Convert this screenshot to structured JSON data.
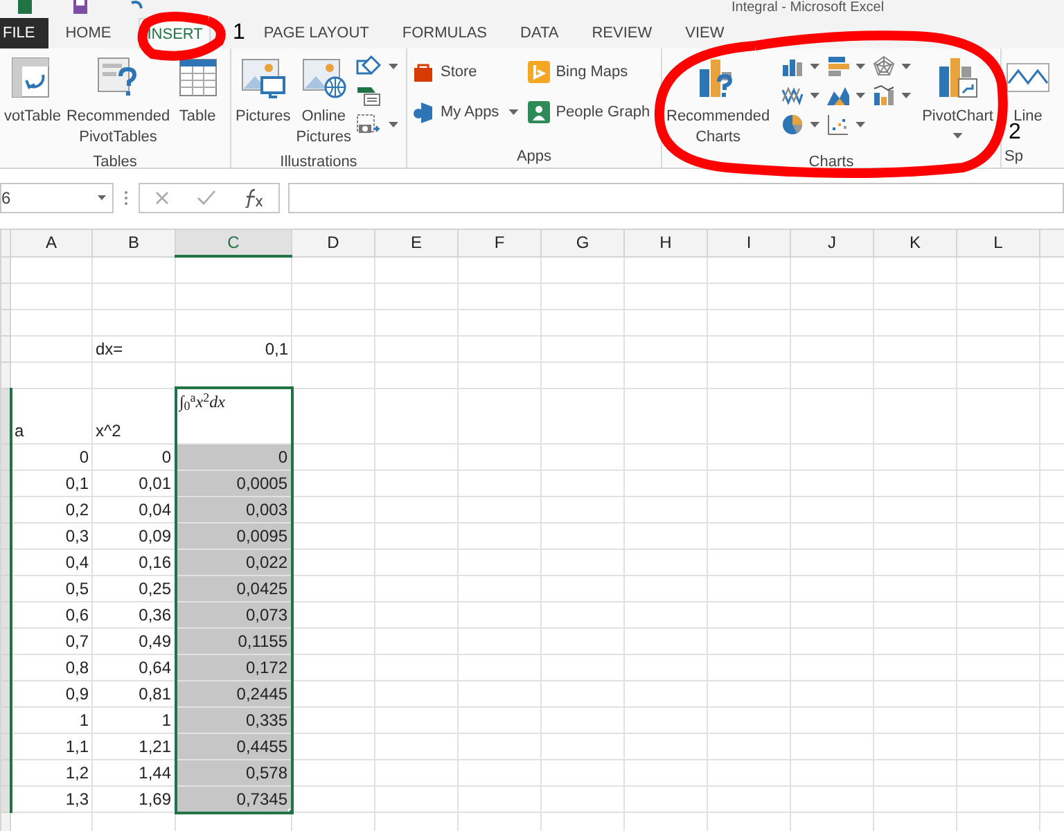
{
  "window": {
    "title": "Integral - Microsoft Excel"
  },
  "tabs": [
    {
      "label": "FILE",
      "kind": "file",
      "selected": false
    },
    {
      "label": "HOME",
      "kind": "tab",
      "selected": false
    },
    {
      "label": "INSERT",
      "kind": "tab",
      "selected": true
    },
    {
      "label": "PAGE LAYOUT",
      "kind": "tab",
      "selected": false
    },
    {
      "label": "FORMULAS",
      "kind": "tab",
      "selected": false
    },
    {
      "label": "DATA",
      "kind": "tab",
      "selected": false
    },
    {
      "label": "REVIEW",
      "kind": "tab",
      "selected": false
    },
    {
      "label": "VIEW",
      "kind": "tab",
      "selected": false
    }
  ],
  "annotations": [
    {
      "text": "1"
    },
    {
      "text": "2"
    }
  ],
  "ribbon": {
    "groups": [
      {
        "label": "Tables",
        "items": [
          {
            "kind": "large",
            "label": "votTable"
          },
          {
            "kind": "large",
            "label": "Recommended PivotTables"
          },
          {
            "kind": "large",
            "label": "Table"
          }
        ]
      },
      {
        "label": "Illustrations",
        "items": [
          {
            "kind": "large",
            "label": "Pictures"
          },
          {
            "kind": "large",
            "label": "Online Pictures"
          },
          {
            "kind": "icon",
            "dropdown": true
          },
          {
            "kind": "icon"
          },
          {
            "kind": "icon",
            "dropdown": true
          }
        ]
      },
      {
        "label": "Apps",
        "items": [
          {
            "kind": "small",
            "label": "Store"
          },
          {
            "kind": "small",
            "label": "My Apps",
            "dropdown": true
          },
          {
            "kind": "small",
            "label": "Bing Maps"
          },
          {
            "kind": "small",
            "label": "People Graph"
          }
        ]
      },
      {
        "label": "Charts",
        "items": [
          {
            "kind": "large",
            "label": "Recommended Charts"
          },
          {
            "kind": "icon",
            "dropdown": true
          },
          {
            "kind": "icon",
            "dropdown": true
          },
          {
            "kind": "icon",
            "dropdown": true
          },
          {
            "kind": "icon",
            "dropdown": true
          },
          {
            "kind": "icon",
            "dropdown": true
          },
          {
            "kind": "icon",
            "dropdown": true
          },
          {
            "kind": "icon",
            "dropdown": true
          },
          {
            "kind": "icon",
            "dropdown": true
          },
          {
            "kind": "large",
            "label": "PivotChart",
            "dropdown": true
          }
        ]
      },
      {
        "label": "Sp",
        "items": [
          {
            "kind": "large",
            "label": "Line"
          }
        ]
      }
    ]
  },
  "formula_bar": {
    "name_box": "6"
  },
  "sheet": {
    "columns": [
      {
        "label": "A",
        "selected": false
      },
      {
        "label": "B",
        "selected": false
      },
      {
        "label": "C",
        "selected": true
      },
      {
        "label": "D",
        "selected": false
      },
      {
        "label": "E",
        "selected": false
      },
      {
        "label": "F",
        "selected": false
      },
      {
        "label": "G",
        "selected": false
      },
      {
        "label": "H",
        "selected": false
      },
      {
        "label": "I",
        "selected": false
      },
      {
        "label": "J",
        "selected": false
      },
      {
        "label": "K",
        "selected": false
      },
      {
        "label": "L",
        "selected": false
      }
    ],
    "rows": [
      {
        "selected": false,
        "active": false
      },
      {
        "selected": false,
        "active": false
      },
      {
        "selected": false,
        "active": false
      },
      {
        "selected": false,
        "active": false,
        "b": {
          "text": "dx=",
          "kind": "text"
        },
        "c": {
          "text": "0,1",
          "kind": "number"
        }
      },
      {
        "selected": false,
        "active": false
      },
      {
        "selected": false,
        "active": true,
        "a": {
          "text": "a",
          "kind": "text"
        },
        "b": {
          "text": "x^2",
          "kind": "text"
        },
        "c": {
          "text": "∫$_{0}$$^{a}$*x*$^{2}$*dx*",
          "kind": "formula"
        }
      },
      {
        "selected": true,
        "active": false,
        "a": {
          "text": "0",
          "kind": "number"
        },
        "b": {
          "text": "0",
          "kind": "number"
        },
        "c": {
          "text": "0",
          "kind": "number"
        }
      },
      {
        "selected": true,
        "active": false,
        "a": {
          "text": "0,1",
          "kind": "number"
        },
        "b": {
          "text": "0,01",
          "kind": "number"
        },
        "c": {
          "text": "0,0005",
          "kind": "number"
        }
      },
      {
        "selected": true,
        "active": false,
        "a": {
          "text": "0,2",
          "kind": "number"
        },
        "b": {
          "text": "0,04",
          "kind": "number"
        },
        "c": {
          "text": "0,003",
          "kind": "number"
        }
      },
      {
        "selected": true,
        "active": false,
        "a": {
          "text": "0,3",
          "kind": "number"
        },
        "b": {
          "text": "0,09",
          "kind": "number"
        },
        "c": {
          "text": "0,0095",
          "kind": "number"
        }
      },
      {
        "selected": true,
        "active": false,
        "a": {
          "text": "0,4",
          "kind": "number"
        },
        "b": {
          "text": "0,16",
          "kind": "number"
        },
        "c": {
          "text": "0,022",
          "kind": "number"
        }
      },
      {
        "selected": true,
        "active": false,
        "a": {
          "text": "0,5",
          "kind": "number"
        },
        "b": {
          "text": "0,25",
          "kind": "number"
        },
        "c": {
          "text": "0,0425",
          "kind": "number"
        }
      },
      {
        "selected": true,
        "active": false,
        "a": {
          "text": "0,6",
          "kind": "number"
        },
        "b": {
          "text": "0,36",
          "kind": "number"
        },
        "c": {
          "text": "0,073",
          "kind": "number"
        }
      },
      {
        "selected": true,
        "active": false,
        "a": {
          "text": "0,7",
          "kind": "number"
        },
        "b": {
          "text": "0,49",
          "kind": "number"
        },
        "c": {
          "text": "0,1155",
          "kind": "number"
        }
      },
      {
        "selected": true,
        "active": false,
        "a": {
          "text": "0,8",
          "kind": "number"
        },
        "b": {
          "text": "0,64",
          "kind": "number"
        },
        "c": {
          "text": "0,172",
          "kind": "number"
        }
      },
      {
        "selected": true,
        "active": false,
        "a": {
          "text": "0,9",
          "kind": "number"
        },
        "b": {
          "text": "0,81",
          "kind": "number"
        },
        "c": {
          "text": "0,2445",
          "kind": "number"
        }
      },
      {
        "selected": true,
        "active": false,
        "a": {
          "text": "1",
          "kind": "number"
        },
        "b": {
          "text": "1",
          "kind": "number"
        },
        "c": {
          "text": "0,335",
          "kind": "number"
        }
      },
      {
        "selected": true,
        "active": false,
        "a": {
          "text": "1,1",
          "kind": "number"
        },
        "b": {
          "text": "1,21",
          "kind": "number"
        },
        "c": {
          "text": "0,4455",
          "kind": "number"
        }
      },
      {
        "selected": true,
        "active": false,
        "a": {
          "text": "1,2",
          "kind": "number"
        },
        "b": {
          "text": "1,44",
          "kind": "number"
        },
        "c": {
          "text": "0,578",
          "kind": "number"
        }
      },
      {
        "selected": true,
        "active": false,
        "a": {
          "text": "1,3",
          "kind": "number"
        },
        "b": {
          "text": "1,69",
          "kind": "number"
        },
        "c": {
          "text": "0,7345",
          "kind": "number"
        }
      },
      {
        "selected": false,
        "active": false
      }
    ]
  }
}
